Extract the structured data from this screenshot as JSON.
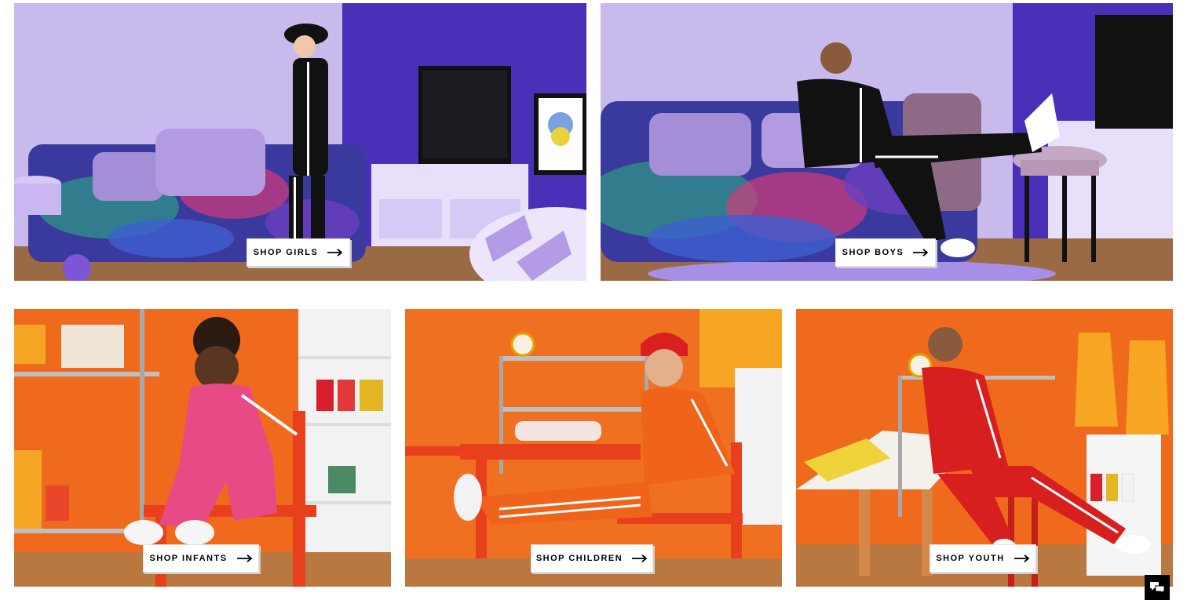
{
  "tiles": [
    {
      "id": "girls",
      "cta": "SHOP GIRLS"
    },
    {
      "id": "boys",
      "cta": "SHOP BOYS"
    },
    {
      "id": "infants",
      "cta": "SHOP INFANTS"
    },
    {
      "id": "children",
      "cta": "SHOP CHILDREN"
    },
    {
      "id": "youth",
      "cta": "SHOP YOUTH"
    }
  ],
  "icons": {
    "arrow": "arrow-right-icon",
    "chat": "chat-icon"
  },
  "colors": {
    "lavender_wall": "#c8b8ec",
    "purple_wall": "#4a2fb8",
    "orange_wall": "#f26a1c",
    "pink_outfit": "#e84a86",
    "red_outfit": "#d81f1f",
    "cta_bg": "#ffffff",
    "cta_text": "#000000"
  }
}
